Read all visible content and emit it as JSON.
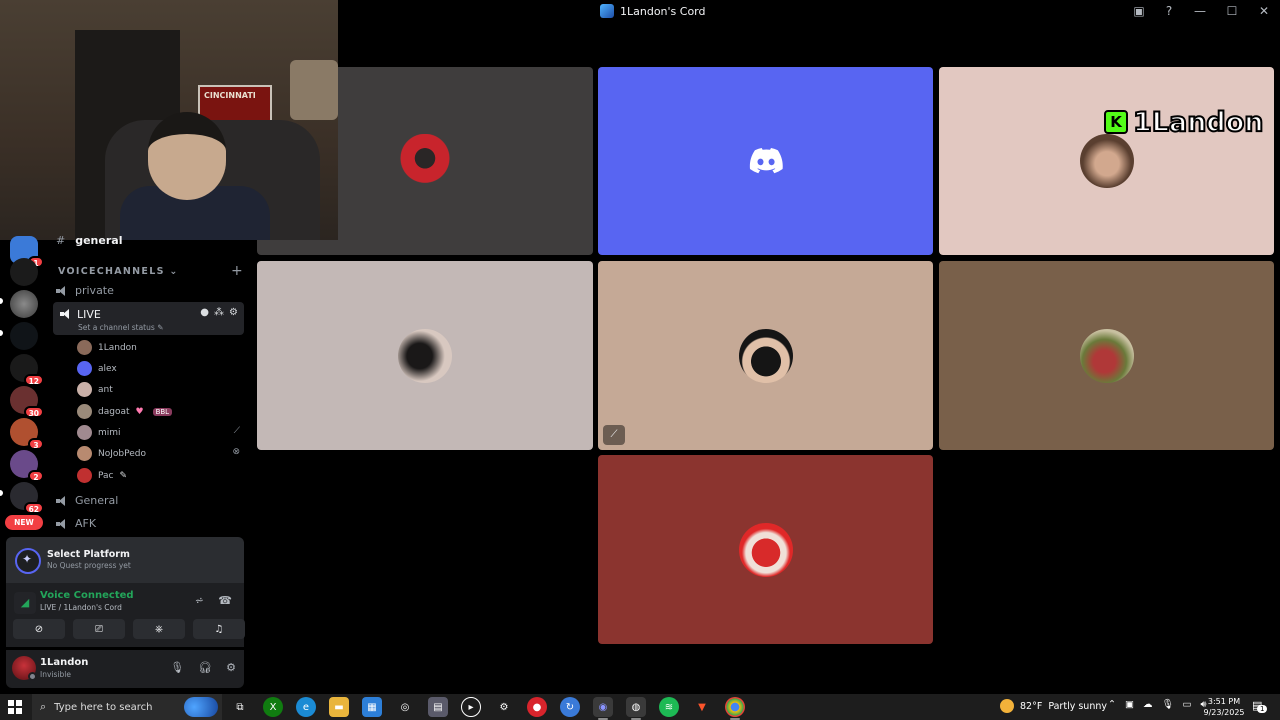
{
  "window": {
    "title": "1Landon's Cord",
    "controls": [
      "—",
      "☐",
      "✕"
    ]
  },
  "webcam": {
    "flag_text": "CINCINNATI"
  },
  "rail": {
    "badges": [
      "1",
      "12",
      "30",
      "3",
      "2",
      "62"
    ],
    "new_label": "NEW"
  },
  "channels": {
    "text_channel": "general",
    "category": "VOICECHANNELS",
    "voice": [
      {
        "name": "private"
      },
      {
        "name": "LIVE",
        "status": "Set a channel status"
      },
      {
        "name": "General"
      },
      {
        "name": "AFK"
      }
    ],
    "members": [
      {
        "name": "1Landon",
        "color": "#8a6a5a"
      },
      {
        "name": "alex",
        "color": "#5865f2"
      },
      {
        "name": "ant",
        "color": "#c9b0a8"
      },
      {
        "name": "dagoat",
        "color": "#9a8a7a",
        "tag": "BBL"
      },
      {
        "name": "mimi",
        "color": "#a08a90"
      },
      {
        "name": "NoJobPedo",
        "color": "#b88a70"
      },
      {
        "name": "Pac",
        "color": "#c03030"
      }
    ]
  },
  "quest": {
    "title": "Select Platform",
    "subtitle": "No Quest progress yet"
  },
  "voice": {
    "status": "Voice Connected",
    "location": "LIVE / 1Landon's Cord",
    "accent": "#23a55a"
  },
  "user": {
    "name": "1Landon",
    "status": "Invisible"
  },
  "stream_overlay": {
    "name": "1Landon",
    "platform_letter": "K"
  },
  "tiles": [
    {
      "bg": "#3f3d3d"
    },
    {
      "bg": "#5865f2"
    },
    {
      "bg": "#e2c8c1"
    },
    {
      "bg": "#c3b8b6"
    },
    {
      "bg": "#c5a996"
    },
    {
      "bg": "#79604a"
    },
    {
      "bg": "#8b342f"
    }
  ],
  "taskbar": {
    "search_placeholder": "Type here to search",
    "weather_temp": "82°F",
    "weather_text": "Partly sunny",
    "time": "3:51 PM",
    "date": "9/23/2025",
    "notif_count": "1"
  }
}
